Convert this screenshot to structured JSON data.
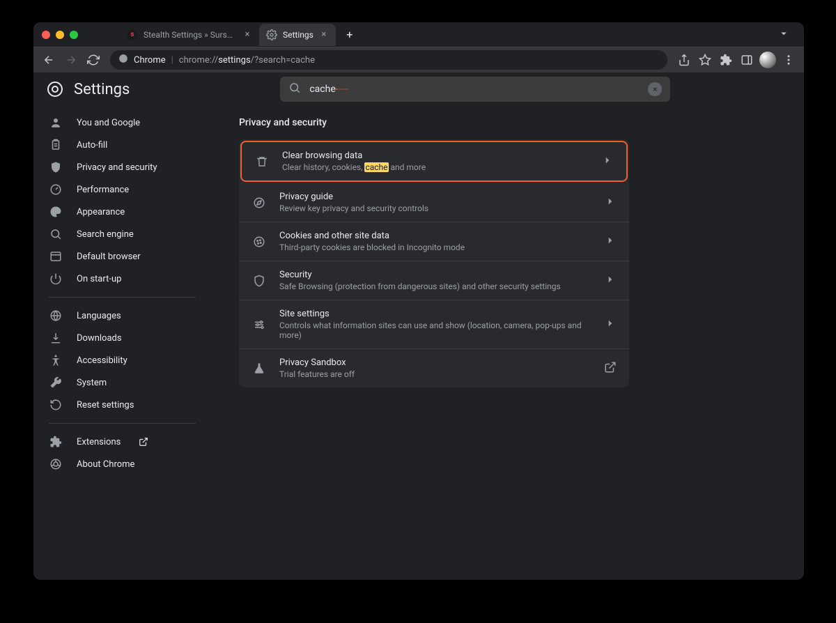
{
  "tabs": [
    {
      "label": "Stealth Settings » Sursa de tut",
      "active": false
    },
    {
      "label": "Settings",
      "active": true
    }
  ],
  "omnibox": {
    "scheme": "Chrome",
    "prefix": "chrome://",
    "strong": "settings",
    "suffix": "/?search=cache"
  },
  "header": {
    "title": "Settings"
  },
  "search": {
    "value": "cache"
  },
  "sidebar": {
    "items1": [
      {
        "label": "You and Google",
        "icon": "user"
      },
      {
        "label": "Auto-fill",
        "icon": "clipboard"
      },
      {
        "label": "Privacy and security",
        "icon": "shield"
      },
      {
        "label": "Performance",
        "icon": "gauge"
      },
      {
        "label": "Appearance",
        "icon": "palette"
      },
      {
        "label": "Search engine",
        "icon": "search"
      },
      {
        "label": "Default browser",
        "icon": "browser"
      },
      {
        "label": "On start-up",
        "icon": "power"
      }
    ],
    "items2": [
      {
        "label": "Languages",
        "icon": "globe"
      },
      {
        "label": "Downloads",
        "icon": "download"
      },
      {
        "label": "Accessibility",
        "icon": "accessibility"
      },
      {
        "label": "System",
        "icon": "wrench"
      },
      {
        "label": "Reset settings",
        "icon": "reset"
      }
    ],
    "items3": [
      {
        "label": "Extensions",
        "icon": "puzzle",
        "external": true
      },
      {
        "label": "About Chrome",
        "icon": "chrome"
      }
    ]
  },
  "section": {
    "title": "Privacy and security"
  },
  "rows": [
    {
      "title": "Clear browsing data",
      "sub_pre": "Clear history, cookies, ",
      "sub_hl": "cache",
      "sub_post": " and more",
      "icon": "trash",
      "highlight": true,
      "trail": "chev"
    },
    {
      "title": "Privacy guide",
      "sub": "Review key privacy and security controls",
      "icon": "compass",
      "trail": "chev"
    },
    {
      "title": "Cookies and other site data",
      "sub": "Third-party cookies are blocked in Incognito mode",
      "icon": "cookie",
      "trail": "chev"
    },
    {
      "title": "Security",
      "sub": "Safe Browsing (protection from dangerous sites) and other security settings",
      "icon": "shield2",
      "trail": "chev"
    },
    {
      "title": "Site settings",
      "sub": "Controls what information sites can use and show (location, camera, pop-ups and more)",
      "icon": "sliders",
      "trail": "chev"
    },
    {
      "title": "Privacy Sandbox",
      "sub": "Trial features are off",
      "icon": "flask",
      "trail": "open"
    }
  ]
}
